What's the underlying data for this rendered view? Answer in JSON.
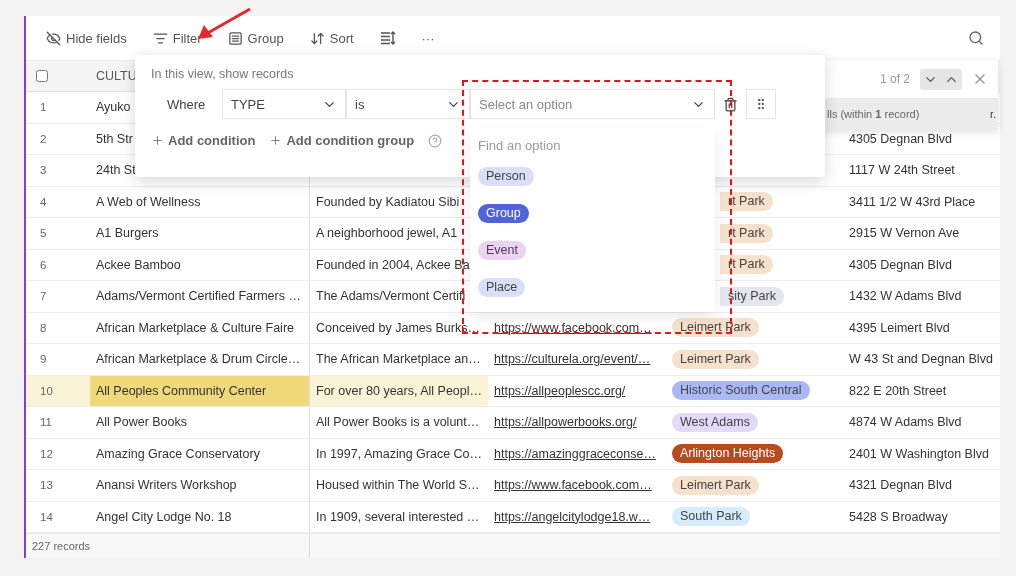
{
  "toolbar": {
    "buttons": [
      {
        "kind": "hide",
        "label": "Hide fields"
      },
      {
        "kind": "filter",
        "label": "Filter"
      },
      {
        "kind": "group",
        "label": "Group"
      },
      {
        "kind": "sort",
        "label": "Sort"
      },
      {
        "kind": "row_height"
      },
      {
        "kind": "more",
        "label": "···"
      }
    ]
  },
  "table": {
    "select_all": {
      "checked": false
    },
    "columns": [
      {
        "label": "CULTU"
      }
    ],
    "rows": [
      {
        "number": "1",
        "selected": false,
        "name": "Ayuko"
      },
      {
        "number": "2",
        "selected": false,
        "name": "5th Str",
        "address": "4305 Degnan Blvd"
      },
      {
        "number": "3",
        "selected": false,
        "name": "24th St",
        "address": "1117 W 24th Street"
      },
      {
        "number": "4",
        "selected": false,
        "name": "A Web of Wellness",
        "description": "Founded by Kadiatou Sibi",
        "neighborhood": {
          "label": "rt Park",
          "color": "#f5e1cc",
          "clipped": true
        },
        "address": "3411 1/2 W 43rd Place"
      },
      {
        "number": "5",
        "selected": false,
        "name": "A1 Burgers",
        "description": "A neighborhood jewel, A1",
        "neighborhood": {
          "label": "rt Park",
          "color": "#f5e1cc",
          "clipped": true
        },
        "address": "2915 W Vernon Ave"
      },
      {
        "number": "6",
        "selected": false,
        "name": "Ackee Bamboo",
        "description": "Founded in 2004, Ackee Ba",
        "neighborhood": {
          "label": "rt Park",
          "color": "#f5e1cc",
          "clipped": true
        },
        "address": "4305 Degnan Blvd"
      },
      {
        "number": "7",
        "selected": false,
        "name": "Adams/Vermont Certified Farmers …",
        "description": "The Adams/Vermont Certifi",
        "neighborhood": {
          "label": "sity Park",
          "color": "#e3e6ef",
          "clipped": true
        },
        "address": "1432 W Adams Blvd"
      },
      {
        "number": "8",
        "selected": false,
        "name": "African Marketplace & Culture Faire",
        "description": "Conceived by James Burks…",
        "url": "https://www.facebook.com…",
        "neighborhood": {
          "label": "Leimert Park",
          "color": "#f5e1cc",
          "clipped": false
        },
        "address": "4395 Leimert Blvd"
      },
      {
        "number": "9",
        "selected": false,
        "name": "African Marketplace & Drum Circle…",
        "description": "The African Marketplace an…",
        "url": "https://culturela.org/event/…",
        "neighborhood": {
          "label": "Leimert Park",
          "color": "#f5e1cc",
          "clipped": false
        },
        "address": "W 43 St and Degnan Blvd"
      },
      {
        "number": "10",
        "selected": true,
        "name": "All Peoples Community Center",
        "description": "For over 80 years, All Peopl…",
        "url": "https://allpeoplescc.org/",
        "neighborhood": {
          "label": "Historic South Central",
          "color": "#aab8f5",
          "clipped": false
        },
        "address": "822 E 20th Street"
      },
      {
        "number": "11",
        "selected": false,
        "name": "All Power Books",
        "description": "All Power Books is a volunt…",
        "url": "https://allpowerbooks.org/",
        "neighborhood": {
          "label": "West Adams",
          "color": "#e3dafa",
          "clipped": false
        },
        "address": "4874 W Adams Blvd"
      },
      {
        "number": "12",
        "selected": false,
        "name": "Amazing Grace Conservatory",
        "description": "In 1997, Amazing Grace Co…",
        "url": "https://amazinggraceconse…",
        "neighborhood": {
          "label": "Arlington Heights",
          "color": "#b84a1f",
          "clipped": false
        },
        "address": "2401 W Washington Blvd"
      },
      {
        "number": "13",
        "selected": false,
        "name": "Anansi Writers Workshop",
        "description": "Housed within The World S…",
        "url": "https://www.facebook.com…",
        "neighborhood": {
          "label": "Leimert Park",
          "color": "#f5e1cc",
          "clipped": false
        },
        "address": "4321 Degnan Blvd"
      },
      {
        "number": "14",
        "selected": false,
        "name": "Angel City Lodge No. 18",
        "description": "In 1909, several interested …",
        "url": "https://angelcitylodge18.w…",
        "neighborhood": {
          "label": "South Park",
          "color": "#d4ecfb",
          "clipped": false
        },
        "address": "5428 S Broadway"
      }
    ],
    "footer": "227 records"
  },
  "filter": {
    "heading": "In this view, show records",
    "conjunction": "Where",
    "field": "TYPE",
    "operator": "is",
    "value_placeholder": "Select an option",
    "actions": [
      "Add condition",
      "Add condition group"
    ]
  },
  "dropdown": {
    "placeholder": "Find an option",
    "options": [
      {
        "label": "Person",
        "color": "#d9dff9"
      },
      {
        "label": "Group",
        "color": "#5163d8"
      },
      {
        "label": "Event",
        "color": "#ecd3f5"
      },
      {
        "label": "Place",
        "color": "#d9dff9"
      }
    ]
  },
  "search_panel": {
    "position": "1 of 2",
    "hint": "lls (within **1** record)",
    "hint_tail": "r."
  }
}
